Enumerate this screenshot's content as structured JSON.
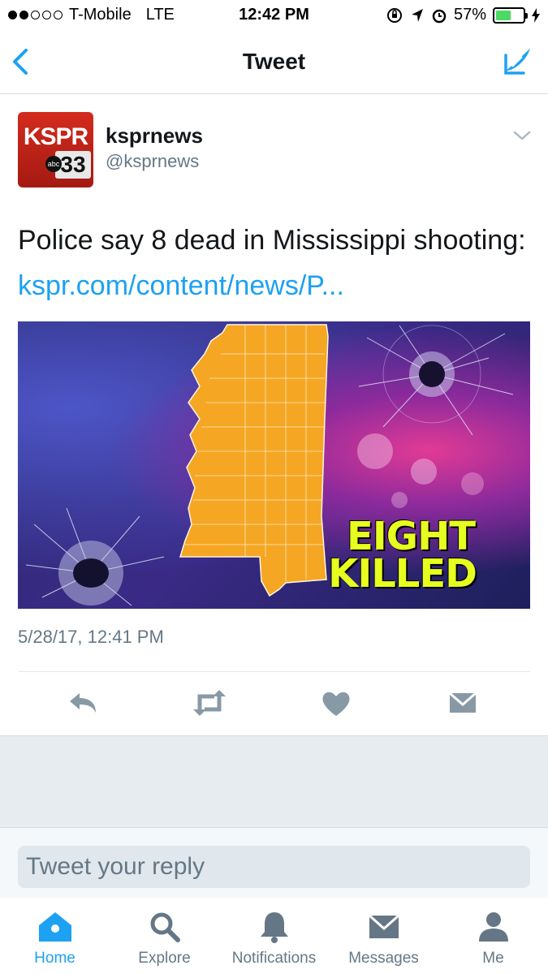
{
  "status_bar": {
    "carrier": "T-Mobile",
    "network": "LTE",
    "time": "12:42 PM",
    "battery_percent": "57%",
    "battery_level": 0.57,
    "signal_bars_filled": 2,
    "signal_bars_total": 5
  },
  "nav": {
    "title": "Tweet",
    "back_icon": "chevron-left-icon",
    "compose_icon": "compose-tweet-icon"
  },
  "tweet": {
    "avatar_text_top": "KSPR",
    "avatar_text_bottom": "33",
    "avatar_network": "abc",
    "display_name": "ksprnews",
    "handle": "@ksprnews",
    "text": "Police say 8 dead in Mississippi shooting: ",
    "link_text": "kspr.com/content/news/P...",
    "media_headline_line1": "EIGHT",
    "media_headline_line2": "KILLED",
    "timestamp": "5/28/17, 12:41 PM"
  },
  "actions": {
    "reply_icon": "reply-icon",
    "retweet_icon": "retweet-icon",
    "like_icon": "heart-icon",
    "dm_icon": "direct-message-icon"
  },
  "reply": {
    "placeholder": "Tweet your reply"
  },
  "tabs": [
    {
      "label": "Home",
      "icon": "home-icon",
      "active": true
    },
    {
      "label": "Explore",
      "icon": "search-icon",
      "active": false
    },
    {
      "label": "Notifications",
      "icon": "bell-icon",
      "active": false
    },
    {
      "label": "Messages",
      "icon": "envelope-icon",
      "active": false
    },
    {
      "label": "Me",
      "icon": "person-icon",
      "active": false
    }
  ],
  "colors": {
    "accent": "#1da1f2",
    "secondary_text": "#657786",
    "icon_gray": "#8899a6",
    "battery_green": "#4cd964",
    "headline_yellow": "#e6ff1f",
    "state_orange": "#f5a623"
  }
}
